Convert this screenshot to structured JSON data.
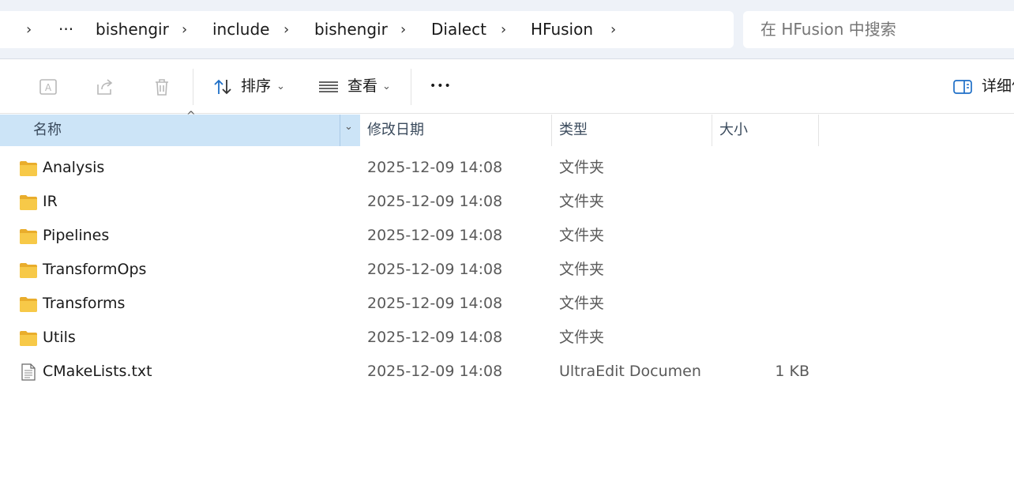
{
  "breadcrumb": {
    "overflow": "···",
    "segments": [
      "bishengir",
      "include",
      "bishengir",
      "Dialect",
      "HFusion"
    ]
  },
  "search": {
    "placeholder": "在 HFusion 中搜索"
  },
  "toolbar": {
    "sort_label": "排序",
    "view_label": "查看",
    "more_label": "•••",
    "details_label": "详细信息"
  },
  "columns": {
    "name": "名称",
    "date": "修改日期",
    "type": "类型",
    "size": "大小"
  },
  "files": [
    {
      "icon": "folder-icon",
      "name": "Analysis",
      "date": "2025-12-09 14:08",
      "type": "文件夹",
      "size": ""
    },
    {
      "icon": "folder-icon",
      "name": "IR",
      "date": "2025-12-09 14:08",
      "type": "文件夹",
      "size": ""
    },
    {
      "icon": "folder-icon",
      "name": "Pipelines",
      "date": "2025-12-09 14:08",
      "type": "文件夹",
      "size": ""
    },
    {
      "icon": "folder-icon",
      "name": "TransformOps",
      "date": "2025-12-09 14:08",
      "type": "文件夹",
      "size": ""
    },
    {
      "icon": "folder-icon",
      "name": "Transforms",
      "date": "2025-12-09 14:08",
      "type": "文件夹",
      "size": ""
    },
    {
      "icon": "folder-icon",
      "name": "Utils",
      "date": "2025-12-09 14:08",
      "type": "文件夹",
      "size": ""
    },
    {
      "icon": "text-file-icon",
      "name": "CMakeLists.txt",
      "date": "2025-12-09 14:08",
      "type": "UltraEdit Documen...",
      "size": "1 KB"
    }
  ],
  "colors": {
    "header_selected": "#cce4f7",
    "folder": "#f7c948",
    "accent": "#1e6fc7"
  }
}
